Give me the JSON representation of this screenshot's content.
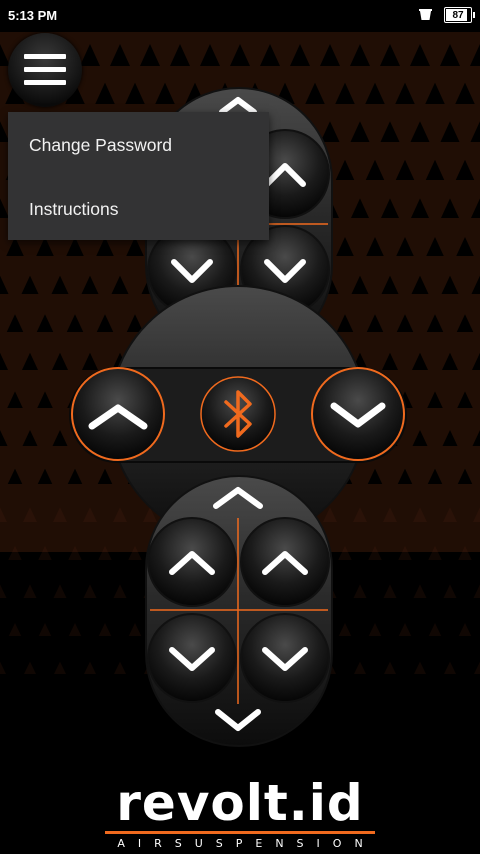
{
  "status_bar": {
    "time": "5:13 PM",
    "battery": "87",
    "battery_level": 0.87,
    "notification_icon": "cup-icon"
  },
  "menu": {
    "items": [
      {
        "label": "Change Password"
      },
      {
        "label": "Instructions"
      }
    ]
  },
  "logo": {
    "name": "revolt.id",
    "tagline": "AIRSUSPENSION"
  },
  "colors": {
    "accent": "#f06a1e",
    "background": "#000000",
    "pattern": "#4a2210",
    "menu": "#333334"
  },
  "controls": {
    "center_icon": "bluetooth-icon"
  }
}
